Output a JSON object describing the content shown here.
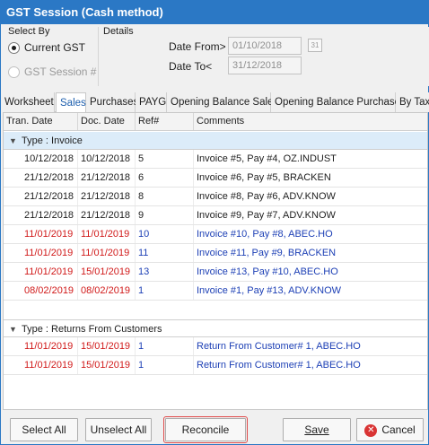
{
  "window": {
    "title": "GST Session (Cash method)"
  },
  "select_by": {
    "label": "Select By",
    "options": [
      {
        "label": "Current GST",
        "checked": true,
        "enabled": true
      },
      {
        "label": "GST Session #",
        "checked": false,
        "enabled": false
      }
    ]
  },
  "details": {
    "label": "Details",
    "date_from_label": "Date From>",
    "date_from_value": "01/10/2018",
    "date_to_label": "Date To<",
    "date_to_value": "31/12/2018",
    "calendar_glyph": "31"
  },
  "tabs": [
    {
      "label": "Worksheet",
      "active": false
    },
    {
      "label": "Sales",
      "active": true
    },
    {
      "label": "Purchases",
      "active": false
    },
    {
      "label": "PAYG",
      "active": false
    },
    {
      "label": "Opening Balance Sales",
      "active": false
    },
    {
      "label": "Opening Balance Purchases",
      "active": false
    },
    {
      "label": "By Tax",
      "active": false
    }
  ],
  "grid": {
    "columns": [
      "Tran. Date",
      "Doc. Date",
      "Ref#",
      "Comments"
    ],
    "groups": [
      {
        "title": "Type : Invoice",
        "rows": [
          {
            "tran_date": "10/12/2018",
            "doc_date": "10/12/2018",
            "ref": "5",
            "comment": "Invoice #5, Pay #4, OZ.INDUST",
            "tran_color": "black",
            "doc_color": "black",
            "ref_color": "black",
            "comment_color": "black"
          },
          {
            "tran_date": "21/12/2018",
            "doc_date": "21/12/2018",
            "ref": "6",
            "comment": "Invoice #6, Pay #5, BRACKEN",
            "tran_color": "black",
            "doc_color": "black",
            "ref_color": "black",
            "comment_color": "black"
          },
          {
            "tran_date": "21/12/2018",
            "doc_date": "21/12/2018",
            "ref": "8",
            "comment": "Invoice #8, Pay #6, ADV.KNOW",
            "tran_color": "black",
            "doc_color": "black",
            "ref_color": "black",
            "comment_color": "black"
          },
          {
            "tran_date": "21/12/2018",
            "doc_date": "21/12/2018",
            "ref": "9",
            "comment": "Invoice #9, Pay #7, ADV.KNOW",
            "tran_color": "black",
            "doc_color": "black",
            "ref_color": "black",
            "comment_color": "black"
          },
          {
            "tran_date": "11/01/2019",
            "doc_date": "11/01/2019",
            "ref": "10",
            "comment": "Invoice #10, Pay #8, ABEC.HO",
            "tran_color": "red",
            "doc_color": "red",
            "ref_color": "blue",
            "comment_color": "blue"
          },
          {
            "tran_date": "11/01/2019",
            "doc_date": "11/01/2019",
            "ref": "11",
            "comment": "Invoice #11, Pay #9, BRACKEN",
            "tran_color": "red",
            "doc_color": "red",
            "ref_color": "blue",
            "comment_color": "blue"
          },
          {
            "tran_date": "11/01/2019",
            "doc_date": "15/01/2019",
            "ref": "13",
            "comment": "Invoice #13, Pay #10, ABEC.HO",
            "tran_color": "red",
            "doc_color": "red",
            "ref_color": "blue",
            "comment_color": "blue"
          },
          {
            "tran_date": "08/02/2019",
            "doc_date": "08/02/2019",
            "ref": "1",
            "comment": "Invoice #1, Pay #13, ADV.KNOW",
            "tran_color": "red",
            "doc_color": "red",
            "ref_color": "blue",
            "comment_color": "blue"
          }
        ]
      },
      {
        "title": "Type : Returns From Customers",
        "rows": [
          {
            "tran_date": "11/01/2019",
            "doc_date": "15/01/2019",
            "ref": "1",
            "comment": "Return From Customer# 1, ABEC.HO",
            "tran_color": "red",
            "doc_color": "red",
            "ref_color": "blue",
            "comment_color": "blue"
          },
          {
            "tran_date": "11/01/2019",
            "doc_date": "15/01/2019",
            "ref": "1",
            "comment": "Return From Customer# 1, ABEC.HO",
            "tran_color": "red",
            "doc_color": "red",
            "ref_color": "blue",
            "comment_color": "blue"
          }
        ]
      }
    ]
  },
  "footer": {
    "select_all": "Select All",
    "unselect_all": "Unselect All",
    "reconcile": "Reconcile",
    "save": "Save",
    "cancel": "Cancel"
  },
  "colors": {
    "titlebar": "#2b78c5",
    "red_text": "#d11a1a",
    "blue_text": "#1c3fb5",
    "active_tab_text": "#1d5fae",
    "selected_group": "#dcecf9"
  }
}
